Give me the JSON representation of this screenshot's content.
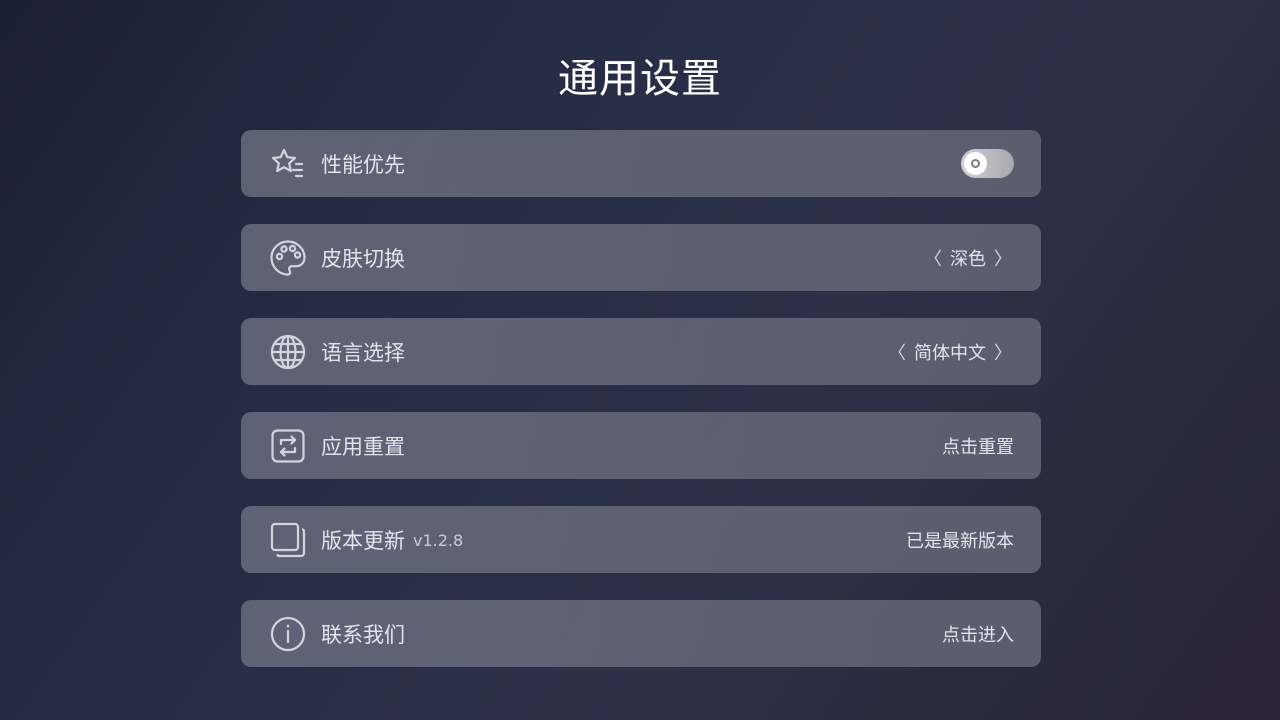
{
  "page": {
    "title": "通用设置"
  },
  "settings": [
    {
      "icon": "star-list-icon",
      "label": "性能优先",
      "control": "toggle",
      "toggle_on": false
    },
    {
      "icon": "palette-icon",
      "label": "皮肤切换",
      "control": "selector",
      "value": "深色",
      "prev_glyph": "〈",
      "next_glyph": "〉"
    },
    {
      "icon": "globe-icon",
      "label": "语言选择",
      "control": "selector",
      "value": "简体中文",
      "prev_glyph": "〈",
      "next_glyph": "〉"
    },
    {
      "icon": "reset-icon",
      "label": "应用重置",
      "control": "action",
      "action": "点击重置"
    },
    {
      "icon": "copy-icon",
      "label": "版本更新",
      "sub": "v1.2.8",
      "control": "action",
      "action": "已是最新版本"
    },
    {
      "icon": "info-icon",
      "label": "联系我们",
      "control": "action",
      "action": "点击进入"
    }
  ],
  "colors": {
    "background_start": "#1a1f33",
    "background_end": "#2a2436",
    "row_background": "#6e7284",
    "text": "#e3e4ea",
    "toggle_track": "#cfcfd3"
  }
}
